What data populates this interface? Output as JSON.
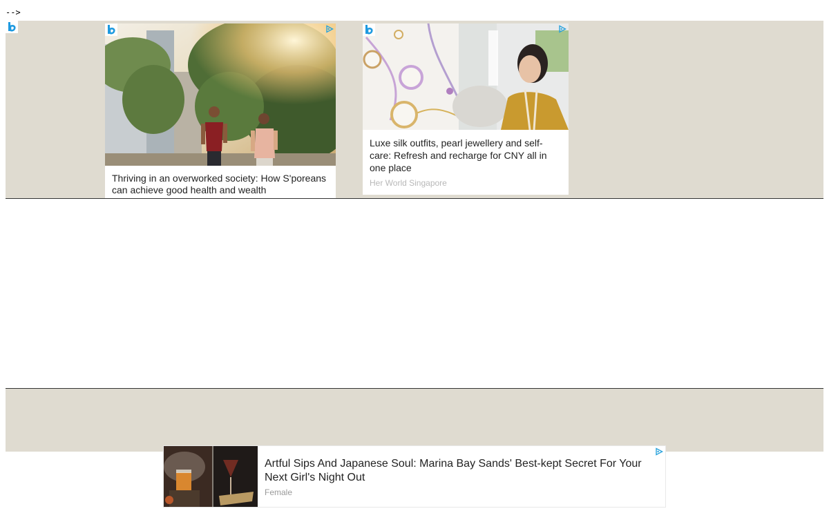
{
  "artifact_text": "-->",
  "colors": {
    "band": "#dfdbd0",
    "brand_blue": "#1e9ae0",
    "title_text": "#222222",
    "source_text": "#b8b8b8"
  },
  "icons": {
    "corner_logo": "b-logo-icon",
    "adchoices": "adchoices-triangle-icon"
  },
  "top_ads": [
    {
      "title": "Thriving in an overworked society: How S'poreans can achieve good health and wealth",
      "source": "",
      "image": "couple-jogging-outdoors-photo"
    },
    {
      "title": "Luxe silk outfits, pearl jewellery and self-care: Refresh and recharge for CNY all in one place",
      "source": "Her World Singapore",
      "image": "pearl-jewellery-and-silk-outfit-photo"
    }
  ],
  "bottom_ad": {
    "title": "Artful Sips And Japanese Soul: Marina Bay Sands' Best-kept Secret For Your Next Girl's Night Out",
    "source": "Female",
    "image": "cocktails-photo"
  }
}
